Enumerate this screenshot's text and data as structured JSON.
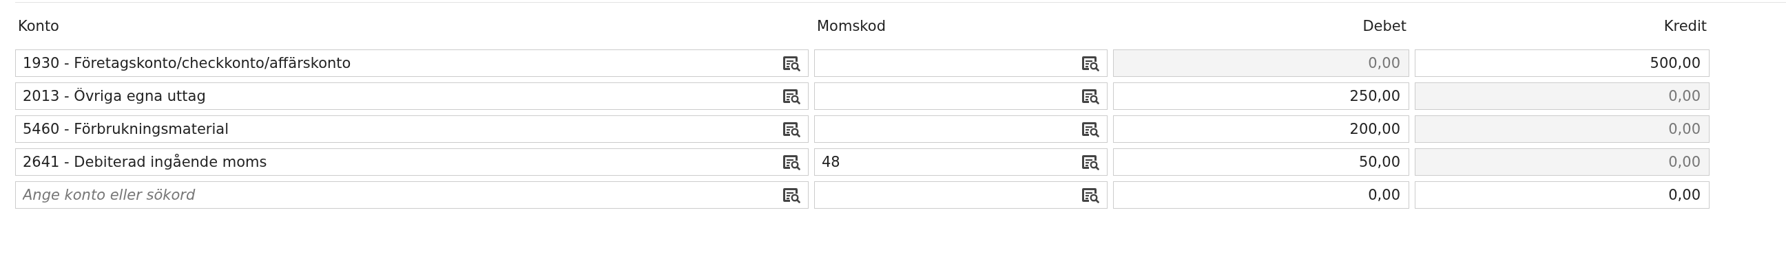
{
  "columns": [
    {
      "label": "Konto",
      "kind": "text"
    },
    {
      "label": "Momskod",
      "kind": "text"
    },
    {
      "label": "Debet",
      "kind": "amount"
    },
    {
      "label": "Kredit",
      "kind": "amount"
    }
  ],
  "rows": [
    {
      "account": {
        "value": "1930 - Företagskonto/checkkonto/affärskonto"
      },
      "vat_code": {},
      "debit": {
        "value": "0,00",
        "disabled": true
      },
      "credit": {
        "value": "500,00",
        "disabled": false
      }
    },
    {
      "account": {
        "value": "2013 - Övriga egna uttag"
      },
      "vat_code": {},
      "debit": {
        "value": "250,00",
        "disabled": false
      },
      "credit": {
        "value": "0,00",
        "disabled": true
      }
    },
    {
      "account": {
        "value": "5460 - Förbrukningsmaterial"
      },
      "vat_code": {},
      "debit": {
        "value": "200,00",
        "disabled": false
      },
      "credit": {
        "value": "0,00",
        "disabled": true
      }
    },
    {
      "account": {
        "value": "2641 - Debiterad ingående moms"
      },
      "vat_code": {
        "value": "48"
      },
      "debit": {
        "value": "50,00",
        "disabled": false
      },
      "credit": {
        "value": "0,00",
        "disabled": true
      }
    },
    {
      "account": {
        "placeholder": "Ange konto eller sökord"
      },
      "vat_code": {},
      "debit": {
        "value": "0,00",
        "disabled": false
      },
      "credit": {
        "value": "0,00",
        "disabled": false
      }
    }
  ]
}
